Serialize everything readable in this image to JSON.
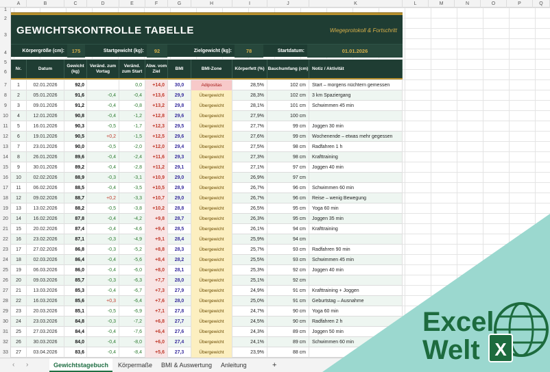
{
  "columns": [
    "A",
    "B",
    "C",
    "D",
    "E",
    "F",
    "G",
    "H",
    "I",
    "J",
    "K",
    "L",
    "M",
    "N",
    "O",
    "P",
    "Q"
  ],
  "rows": [
    "1",
    "2",
    "3",
    "4",
    "5",
    "6",
    "7",
    "8",
    "9",
    "10",
    "11",
    "12",
    "13",
    "14",
    "15",
    "16",
    "17",
    "18",
    "19",
    "20",
    "21",
    "22",
    "23",
    "24",
    "25",
    "26",
    "27",
    "28",
    "29",
    "30",
    "31",
    "32",
    "33"
  ],
  "header": {
    "title": "GEWICHTSKONTROLLE  TABELLE",
    "subtitle": "Wiegeprotokoll & Fortschritt"
  },
  "info": {
    "height_label": "Körpergröße (cm):",
    "height_value": "175",
    "start_weight_label": "Startgewicht (kg):",
    "start_weight_value": "92",
    "target_weight_label": "Zielgewicht (kg):",
    "target_weight_value": "78",
    "start_date_label": "Startdatum:",
    "start_date_value": "01.01.2026"
  },
  "table": {
    "headers": {
      "nr": "Nr.",
      "date": "Datum",
      "weight": "Gewicht (kg)",
      "change_prev": "Veränd. zum Vortag",
      "change_start": "Veränd. zum Start",
      "deviation": "Abw. vom Ziel",
      "bmi": "BMI",
      "zone": "BMI-Zone",
      "body_fat": "Körperfett (%)",
      "waist": "Bauchumfang (cm)",
      "note": "Notiz / Aktivität"
    },
    "rows": [
      {
        "nr": "1",
        "date": "02.01.2026",
        "w": "92,0",
        "d": "",
        "s": "0,0",
        "a": "+14,0",
        "bmi": "30,0",
        "zone": "Adipositas",
        "kfa": "28,5%",
        "b": "102 cm",
        "n": "Start – morgens nüchtern gemessen"
      },
      {
        "nr": "2",
        "date": "05.01.2026",
        "w": "91,6",
        "d": "-0,4",
        "s": "-0,4",
        "a": "+13,6",
        "bmi": "29,9",
        "zone": "Übergewicht",
        "kfa": "28,3%",
        "b": "102 cm",
        "n": "3 km Spaziergang"
      },
      {
        "nr": "3",
        "date": "09.01.2026",
        "w": "91,2",
        "d": "-0,4",
        "s": "-0,8",
        "a": "+13,2",
        "bmi": "29,8",
        "zone": "Übergewicht",
        "kfa": "28,1%",
        "b": "101 cm",
        "n": "Schwimmen 45 min"
      },
      {
        "nr": "4",
        "date": "12.01.2026",
        "w": "90,8",
        "d": "-0,4",
        "s": "-1,2",
        "a": "+12,8",
        "bmi": "29,6",
        "zone": "Übergewicht",
        "kfa": "27,9%",
        "b": "100 cm",
        "n": ""
      },
      {
        "nr": "5",
        "date": "16.01.2026",
        "w": "90,3",
        "d": "-0,5",
        "s": "-1,7",
        "a": "+12,3",
        "bmi": "29,5",
        "zone": "Übergewicht",
        "kfa": "27,7%",
        "b": "99 cm",
        "n": "Joggen 30 min"
      },
      {
        "nr": "6",
        "date": "19.01.2026",
        "w": "90,5",
        "d": "+0,2",
        "s": "-1,5",
        "a": "+12,5",
        "bmi": "29,6",
        "zone": "Übergewicht",
        "kfa": "27,6%",
        "b": "99 cm",
        "n": "Wochenende – etwas mehr gegessen"
      },
      {
        "nr": "7",
        "date": "23.01.2026",
        "w": "90,0",
        "d": "-0,5",
        "s": "-2,0",
        "a": "+12,0",
        "bmi": "29,4",
        "zone": "Übergewicht",
        "kfa": "27,5%",
        "b": "98 cm",
        "n": "Radfahren 1 h"
      },
      {
        "nr": "8",
        "date": "26.01.2026",
        "w": "89,6",
        "d": "-0,4",
        "s": "-2,4",
        "a": "+11,6",
        "bmi": "29,3",
        "zone": "Übergewicht",
        "kfa": "27,3%",
        "b": "98 cm",
        "n": "Krafttraining"
      },
      {
        "nr": "9",
        "date": "30.01.2026",
        "w": "89,2",
        "d": "-0,4",
        "s": "-2,8",
        "a": "+11,2",
        "bmi": "29,1",
        "zone": "Übergewicht",
        "kfa": "27,1%",
        "b": "97 cm",
        "n": "Joggen 40 min"
      },
      {
        "nr": "10",
        "date": "02.02.2026",
        "w": "88,9",
        "d": "-0,3",
        "s": "-3,1",
        "a": "+10,9",
        "bmi": "29,0",
        "zone": "Übergewicht",
        "kfa": "26,9%",
        "b": "97 cm",
        "n": ""
      },
      {
        "nr": "11",
        "date": "06.02.2026",
        "w": "88,5",
        "d": "-0,4",
        "s": "-3,5",
        "a": "+10,5",
        "bmi": "28,9",
        "zone": "Übergewicht",
        "kfa": "26,7%",
        "b": "96 cm",
        "n": "Schwimmen 60 min"
      },
      {
        "nr": "12",
        "date": "09.02.2026",
        "w": "88,7",
        "d": "+0,2",
        "s": "-3,3",
        "a": "+10,7",
        "bmi": "29,0",
        "zone": "Übergewicht",
        "kfa": "26,7%",
        "b": "96 cm",
        "n": "Reise – wenig Bewegung"
      },
      {
        "nr": "13",
        "date": "13.02.2026",
        "w": "88,2",
        "d": "-0,5",
        "s": "-3,8",
        "a": "+10,2",
        "bmi": "28,8",
        "zone": "Übergewicht",
        "kfa": "26,5%",
        "b": "95 cm",
        "n": "Yoga 60 min"
      },
      {
        "nr": "14",
        "date": "16.02.2026",
        "w": "87,8",
        "d": "-0,4",
        "s": "-4,2",
        "a": "+9,8",
        "bmi": "28,7",
        "zone": "Übergewicht",
        "kfa": "26,3%",
        "b": "95 cm",
        "n": "Joggen 35 min"
      },
      {
        "nr": "15",
        "date": "20.02.2026",
        "w": "87,4",
        "d": "-0,4",
        "s": "-4,6",
        "a": "+9,4",
        "bmi": "28,5",
        "zone": "Übergewicht",
        "kfa": "26,1%",
        "b": "94 cm",
        "n": "Krafttraining"
      },
      {
        "nr": "16",
        "date": "23.02.2026",
        "w": "87,1",
        "d": "-0,3",
        "s": "-4,9",
        "a": "+9,1",
        "bmi": "28,4",
        "zone": "Übergewicht",
        "kfa": "25,9%",
        "b": "94 cm",
        "n": ""
      },
      {
        "nr": "17",
        "date": "27.02.2026",
        "w": "86,8",
        "d": "-0,3",
        "s": "-5,2",
        "a": "+8,8",
        "bmi": "28,3",
        "zone": "Übergewicht",
        "kfa": "25,7%",
        "b": "93 cm",
        "n": "Radfahren 90 min"
      },
      {
        "nr": "18",
        "date": "02.03.2026",
        "w": "86,4",
        "d": "-0,4",
        "s": "-5,6",
        "a": "+8,4",
        "bmi": "28,2",
        "zone": "Übergewicht",
        "kfa": "25,5%",
        "b": "93 cm",
        "n": "Schwimmen 45 min"
      },
      {
        "nr": "19",
        "date": "06.03.2026",
        "w": "86,0",
        "d": "-0,4",
        "s": "-6,0",
        "a": "+8,0",
        "bmi": "28,1",
        "zone": "Übergewicht",
        "kfa": "25,3%",
        "b": "92 cm",
        "n": "Joggen 40 min"
      },
      {
        "nr": "20",
        "date": "09.03.2026",
        "w": "85,7",
        "d": "-0,3",
        "s": "-6,3",
        "a": "+7,7",
        "bmi": "28,0",
        "zone": "Übergewicht",
        "kfa": "25,1%",
        "b": "92 cm",
        "n": ""
      },
      {
        "nr": "21",
        "date": "13.03.2026",
        "w": "85,3",
        "d": "-0,4",
        "s": "-6,7",
        "a": "+7,3",
        "bmi": "27,9",
        "zone": "Übergewicht",
        "kfa": "24,9%",
        "b": "91 cm",
        "n": "Krafttraining + Joggen"
      },
      {
        "nr": "22",
        "date": "16.03.2026",
        "w": "85,6",
        "d": "+0,3",
        "s": "-6,4",
        "a": "+7,6",
        "bmi": "28,0",
        "zone": "Übergewicht",
        "kfa": "25,0%",
        "b": "91 cm",
        "n": "Geburtstag – Ausnahme"
      },
      {
        "nr": "23",
        "date": "20.03.2026",
        "w": "85,1",
        "d": "-0,5",
        "s": "-6,9",
        "a": "+7,1",
        "bmi": "27,8",
        "zone": "Übergewicht",
        "kfa": "24,7%",
        "b": "90 cm",
        "n": "Yoga 60 min"
      },
      {
        "nr": "24",
        "date": "23.03.2026",
        "w": "84,8",
        "d": "-0,3",
        "s": "-7,2",
        "a": "+6,8",
        "bmi": "27,7",
        "zone": "Übergewicht",
        "kfa": "24,5%",
        "b": "90 cm",
        "n": "Radfahren 2 h"
      },
      {
        "nr": "25",
        "date": "27.03.2026",
        "w": "84,4",
        "d": "-0,4",
        "s": "-7,6",
        "a": "+6,4",
        "bmi": "27,6",
        "zone": "Übergewicht",
        "kfa": "24,3%",
        "b": "89 cm",
        "n": "Joggen 50 min"
      },
      {
        "nr": "26",
        "date": "30.03.2026",
        "w": "84,0",
        "d": "-0,4",
        "s": "-8,0",
        "a": "+6,0",
        "bmi": "27,4",
        "zone": "Übergewicht",
        "kfa": "24,1%",
        "b": "89 cm",
        "n": "Schwimmen 60 min"
      },
      {
        "nr": "27",
        "date": "03.04.2026",
        "w": "83,6",
        "d": "-0,4",
        "s": "-8,4",
        "a": "+5,6",
        "bmi": "27,3",
        "zone": "Übergewicht",
        "kfa": "23,9%",
        "b": "88 cm",
        "n": ""
      }
    ]
  },
  "tabs": {
    "active": "Gewichtstagebuch",
    "t2": "Körpermaße",
    "t3": "BMI & Auswertung",
    "t4": "Anleitung",
    "add": "+",
    "prev": "‹",
    "next": "›"
  },
  "logo": {
    "line1": "Excel",
    "line2": "Welt",
    "badge": "X",
    "bg_color": "#9bd8cf",
    "text_color": "#1d6b3e"
  }
}
